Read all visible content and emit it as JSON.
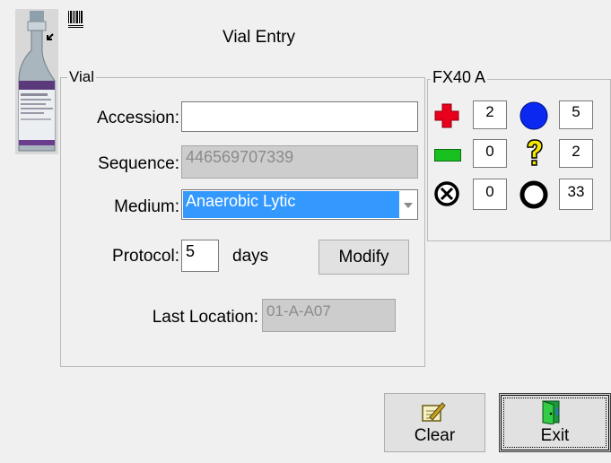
{
  "window": {
    "title": "Vial Entry"
  },
  "vial_group": {
    "legend": "Vial",
    "accession": {
      "label": "Accession:",
      "value": ""
    },
    "sequence": {
      "label": "Sequence:",
      "value": "446569707339"
    },
    "medium": {
      "label": "Medium:",
      "value": "Anaerobic Lytic"
    },
    "protocol": {
      "label": "Protocol:",
      "value": "5",
      "unit": "days"
    },
    "modify_button": "Modify",
    "last_location": {
      "label": "Last Location:",
      "value": "01-A-A07"
    }
  },
  "instrument": {
    "legend": "FX40 A",
    "counts": [
      {
        "icon": "red-cross-icon",
        "value": "2"
      },
      {
        "icon": "blue-circle-icon",
        "value": "5"
      },
      {
        "icon": "green-rectangle-icon",
        "value": "0"
      },
      {
        "icon": "yellow-question-icon",
        "value": "2"
      },
      {
        "icon": "circled-x-icon",
        "value": "0"
      },
      {
        "icon": "open-circle-icon",
        "value": "33"
      }
    ]
  },
  "buttons": {
    "clear": "Clear",
    "exit": "Exit"
  },
  "colors": {
    "selection": "#3399ff",
    "red": "#e8001c",
    "blue": "#0a28f0",
    "green": "#18c020",
    "yellow": "#f5e600"
  }
}
